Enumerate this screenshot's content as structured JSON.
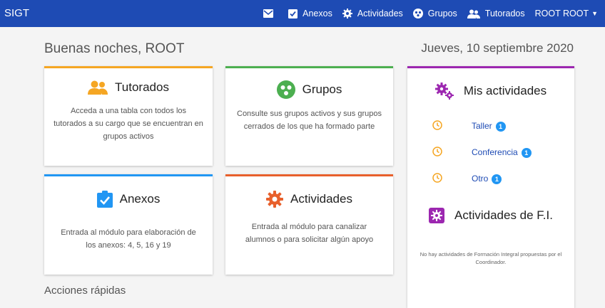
{
  "app": {
    "brand": "SIGT"
  },
  "nav": {
    "anexos": "Anexos",
    "actividades": "Actividades",
    "grupos": "Grupos",
    "tutorados": "Tutorados",
    "user": "ROOT ROOT"
  },
  "greeting": "Buenas noches, ROOT",
  "date": "Jueves, 10 septiembre 2020",
  "cards": {
    "tutorados": {
      "title": "Tutorados",
      "desc": "Acceda a una tabla con todos los tutorados a su cargo que se encuentran en grupos activos",
      "accent": "#f5a623"
    },
    "grupos": {
      "title": "Grupos",
      "desc": "Consulte sus grupos activos y sus grupos cerrados de los que ha formado parte",
      "accent": "#4caf50"
    },
    "anexos": {
      "title": "Anexos",
      "desc": "Entrada al módulo para elaboración de los anexos: 4, 5, 16 y 19",
      "accent": "#2196f3"
    },
    "actividades": {
      "title": "Actividades",
      "desc": "Entrada al módulo para canalizar alumnos o para solicitar algún apoyo",
      "accent": "#e8602c"
    }
  },
  "mis_actividades": {
    "title": "Mis actividades",
    "items": [
      {
        "label": "Taller",
        "count": "1"
      },
      {
        "label": "Conferencia",
        "count": "1"
      },
      {
        "label": "Otro",
        "count": "1"
      }
    ],
    "fi_title": "Actividades de F.I.",
    "fi_empty": "No hay actividades de Formación Integral propuestas por el Coordinador.",
    "accent": "#9c27b0"
  },
  "quick_actions": "Acciones rápidas"
}
